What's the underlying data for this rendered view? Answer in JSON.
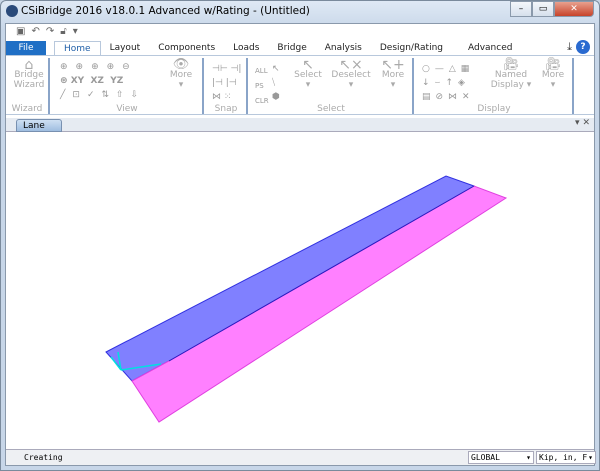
{
  "window": {
    "title": "CSiBridge 2016 v18.0.1 Advanced w/Rating  - (Untitled)",
    "controls": {
      "minimize": "–",
      "restore": "▭",
      "close": "✕"
    }
  },
  "quick_access": [
    "save-icon",
    "undo-icon",
    "redo-icon",
    "lock-icon",
    "customize-icon"
  ],
  "tabs": [
    "File",
    "Home",
    "Layout",
    "Components",
    "Loads",
    "Bridge",
    "Analysis",
    "Design/Rating",
    "Advanced"
  ],
  "active_tab": "Home",
  "ribbon": {
    "wizard": {
      "label": "Bridge Wizard",
      "group": "Wizard"
    },
    "view": {
      "group": "View",
      "row2": [
        "XY",
        "XZ",
        "YZ"
      ],
      "more": "More"
    },
    "snap": {
      "group": "Snap"
    },
    "select": {
      "group": "Select",
      "small": [
        "ALL",
        "PS",
        "CLR"
      ],
      "select": "Select",
      "deselect": "Deselect",
      "more": "More"
    },
    "display": {
      "group": "Display",
      "named_display": "Named Display",
      "more": "More"
    }
  },
  "document_tab": "Lane",
  "viewport": {
    "colors": {
      "lane_top": "#8080ff",
      "lane_bottom": "#ff80ff",
      "edge": "#3030e0",
      "axes": "#00e0e0"
    }
  },
  "status": {
    "text": "Creating",
    "coord_system": "GLOBAL",
    "units": "Kip, in, F"
  }
}
